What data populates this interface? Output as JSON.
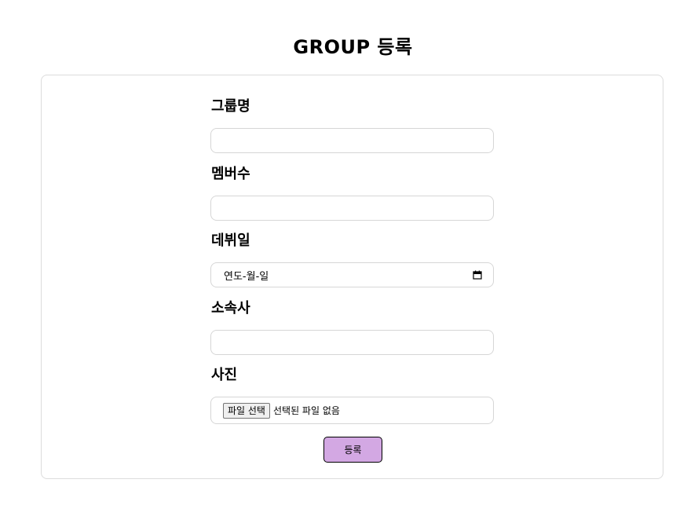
{
  "page": {
    "title": "GROUP 등록"
  },
  "form": {
    "group_name": {
      "label": "그룹명",
      "value": ""
    },
    "member_count": {
      "label": "멤버수",
      "value": ""
    },
    "debut_date": {
      "label": "데뷔일",
      "placeholder": "연도-월-일"
    },
    "agency": {
      "label": "소속사",
      "value": ""
    },
    "photo": {
      "label": "사진",
      "button_label": "파일 선택",
      "status_text": "선택된 파일 없음"
    },
    "submit_label": "등록"
  }
}
